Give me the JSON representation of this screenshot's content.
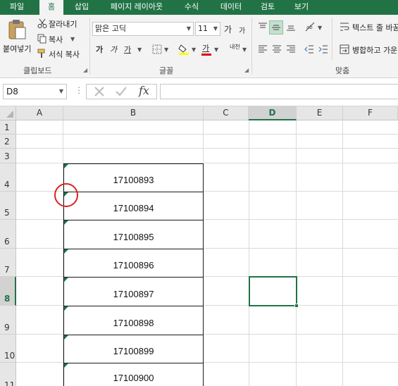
{
  "tabs": [
    {
      "label": "파일",
      "active": false
    },
    {
      "label": "홈",
      "active": true
    },
    {
      "label": "삽입",
      "active": false
    },
    {
      "label": "페이지 레이아웃",
      "active": false
    },
    {
      "label": "수식",
      "active": false
    },
    {
      "label": "데이터",
      "active": false
    },
    {
      "label": "검토",
      "active": false
    },
    {
      "label": "보기",
      "active": false
    }
  ],
  "clipboard": {
    "paste_label": "붙여넣기",
    "cut_label": "잘라내기",
    "copy_label": "복사",
    "format_painter_label": "서식 복사",
    "group_label": "클립보드"
  },
  "font": {
    "name": "맑은 고딕",
    "size": "11",
    "grow_label": "가",
    "shrink_label": "가",
    "bold": "가",
    "italic": "가",
    "underline": "가",
    "font_color_glyph": "가",
    "phonetic_label": "내천",
    "group_label": "글꼴"
  },
  "alignment": {
    "wrap_text_label": "텍스트 줄 바꿈",
    "merge_label": "병합하고 가운데",
    "group_label": "맞춤"
  },
  "formula_bar": {
    "name_box": "D8",
    "fx_label": "fx",
    "value": ""
  },
  "columns": [
    {
      "label": "A",
      "selected": false
    },
    {
      "label": "B",
      "selected": false
    },
    {
      "label": "C",
      "selected": false
    },
    {
      "label": "D",
      "selected": true
    },
    {
      "label": "E",
      "selected": false
    },
    {
      "label": "F",
      "selected": false
    }
  ],
  "rows": [
    {
      "label": "1",
      "selected": false
    },
    {
      "label": "2",
      "selected": false
    },
    {
      "label": "3",
      "selected": false
    },
    {
      "label": "4",
      "selected": false
    },
    {
      "label": "5",
      "selected": false
    },
    {
      "label": "6",
      "selected": false
    },
    {
      "label": "7",
      "selected": false
    },
    {
      "label": "8",
      "selected": true
    },
    {
      "label": "9",
      "selected": false
    },
    {
      "label": "10",
      "selected": false
    },
    {
      "label": "11",
      "selected": false
    }
  ],
  "cells_B": [
    "17100893",
    "17100894",
    "17100895",
    "17100896",
    "17100897",
    "17100898",
    "17100899",
    "17100900"
  ],
  "colors": {
    "accent": "#217346",
    "annotation_circle": "#e02020"
  }
}
